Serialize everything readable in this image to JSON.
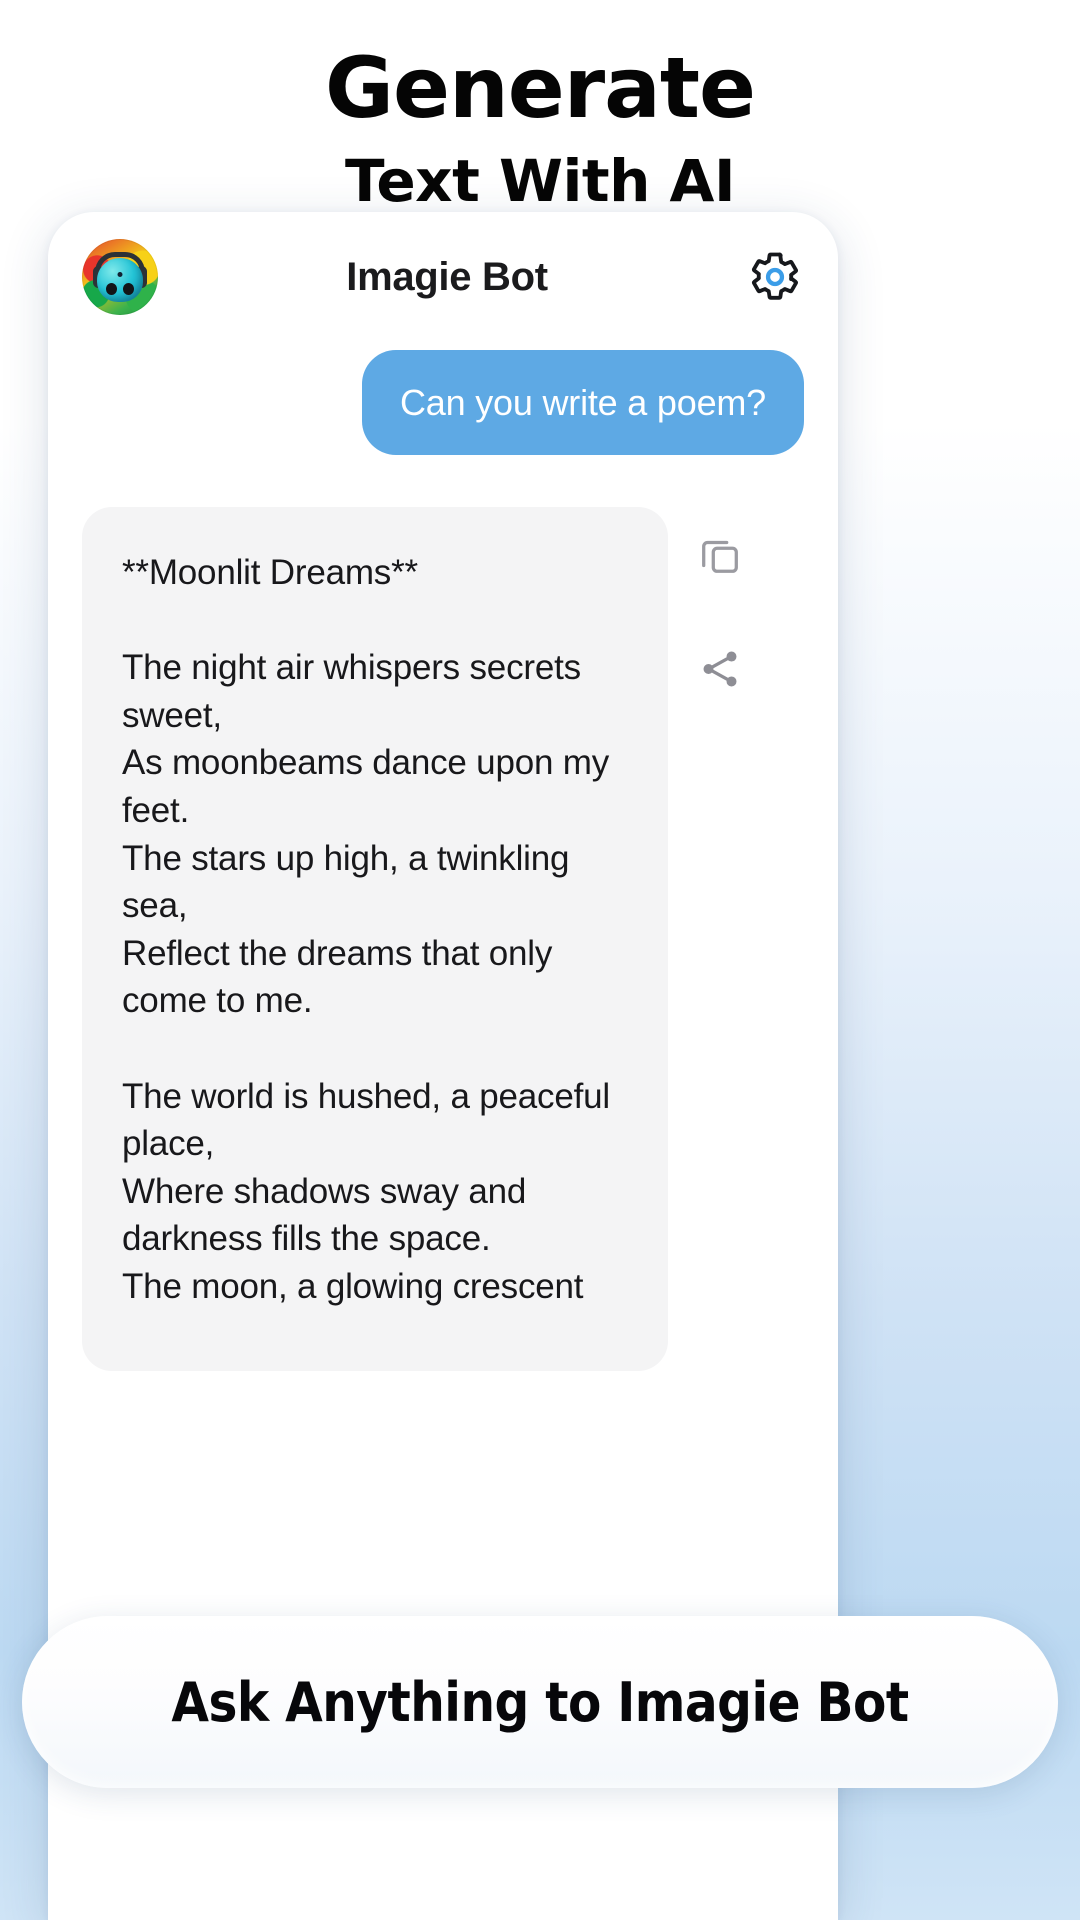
{
  "headline": {
    "line1": "Generate",
    "line2": "Text With AI"
  },
  "phone": {
    "header": {
      "avatar_name": "bot-avatar",
      "title": "Imagie Bot",
      "settings_icon": "gear-icon"
    },
    "messages": [
      {
        "role": "user",
        "text": "Can you write a poem?"
      },
      {
        "role": "assistant",
        "text": "**Moonlit Dreams**\n\nThe night air whispers secrets sweet,\nAs moonbeams dance upon my feet.\nThe stars up high, a twinkling sea,\nReflect the dreams that only come to me.\n\nThe world is hushed, a peaceful place,\nWhere shadows sway and darkness fills the space.\nThe moon, a glowing crescent"
      }
    ],
    "actions": {
      "copy_icon": "copy-icon",
      "share_icon": "share-icon"
    }
  },
  "cta": {
    "label": "Ask Anything to Imagie Bot"
  },
  "colors": {
    "user_bubble": "#5EA9E4",
    "bot_bubble": "#F4F4F5",
    "gear_accent": "#3B9DE8",
    "text_primary": "#18181B",
    "page_bg_top": "#FFFFFF",
    "page_bg_bottom": "#BCD9F2"
  }
}
